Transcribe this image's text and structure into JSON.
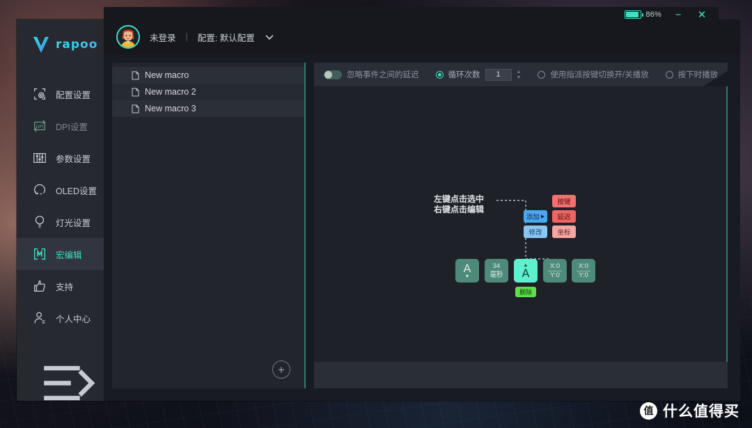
{
  "window": {
    "battery_label": "86%",
    "battery_level": 86,
    "minimize_glyph": "−",
    "close_glyph": "✕",
    "accent_color": "#3de0c2"
  },
  "sidebar": {
    "brand": "rapoo",
    "items": [
      {
        "label": "配置设置",
        "icon": "config-icon",
        "state": "normal"
      },
      {
        "label": "DPI设置",
        "icon": "dpi-icon",
        "state": "dim"
      },
      {
        "label": "参数设置",
        "icon": "sliders-icon",
        "state": "normal"
      },
      {
        "label": "OLED设置",
        "icon": "oled-icon",
        "state": "normal"
      },
      {
        "label": "灯光设置",
        "icon": "bulb-icon",
        "state": "normal"
      },
      {
        "label": "宏编辑",
        "icon": "macro-icon",
        "state": "active"
      },
      {
        "label": "支持",
        "icon": "thumbs-up-icon",
        "state": "normal"
      },
      {
        "label": "个人中心",
        "icon": "user-icon",
        "state": "normal"
      }
    ],
    "collapse_icon": "collapse-icon"
  },
  "header": {
    "account": "未登录",
    "separator": "|",
    "profile": "配置: 默认配置",
    "caret": "⌄"
  },
  "macro_list": {
    "items": [
      {
        "name": "New macro"
      },
      {
        "name": "New macro 2"
      },
      {
        "name": "New macro 3"
      }
    ],
    "add_glyph": "+"
  },
  "toolbar": {
    "ignore_delay_label": "忽略事件之间的延迟",
    "ignore_delay_on": false,
    "loop_count_label": "循环次数",
    "loop_count_selected": true,
    "loop_count_value": "1",
    "spin_up": "▲",
    "spin_down": "▼",
    "toggle_play_label": "使用指派按键切换开/关播放",
    "toggle_play_selected": false,
    "press_play_label": "按下时播放",
    "press_play_selected": false
  },
  "canvas": {
    "annotation": "左键点击选中\n右键点击编辑",
    "context_menu": {
      "add_label": "添加",
      "add_arrow": "▶",
      "modify_label": "修改",
      "submenu": [
        {
          "label": "按键"
        },
        {
          "label": "延迟"
        },
        {
          "label": "坐标"
        }
      ]
    },
    "nodes": [
      {
        "type": "key",
        "main": "A",
        "caret": "▼",
        "caret_pos": "bottom",
        "selected": false
      },
      {
        "type": "delay",
        "top": "34",
        "bottom": "毫秒",
        "selected": false
      },
      {
        "type": "key",
        "main": "A",
        "caret": "▲",
        "caret_pos": "top",
        "selected": true
      },
      {
        "type": "coord",
        "top": "X:0",
        "bottom": "Y:0",
        "selected": false
      },
      {
        "type": "coord",
        "top": "X:0",
        "bottom": "Y:0",
        "selected": false
      }
    ],
    "delete_label": "删除"
  },
  "watermark": {
    "badge": "值",
    "text": "什么值得买"
  }
}
